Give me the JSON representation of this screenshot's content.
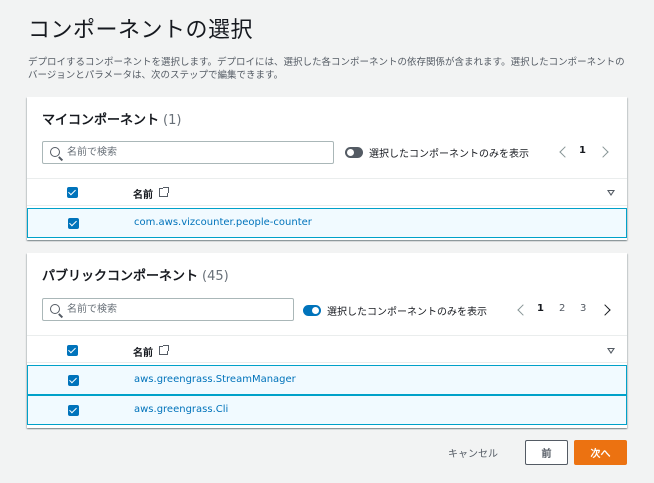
{
  "page": {
    "title": "コンポーネントの選択",
    "description": "デプロイするコンポーネントを選択します。デプロイには、選択した各コンポーネントの依存関係が含まれます。選択したコンポーネントのバージョンとパラメータは、次のステップで編集できます。"
  },
  "my_components": {
    "title": "マイコンポーネント",
    "count": "(1)",
    "search_placeholder": "名前で検索",
    "toggle_label": "選択したコンポーネントのみを表示",
    "toggle_on": false,
    "pages": [
      "1"
    ],
    "current_page": "1",
    "column_name": "名前",
    "rows": [
      {
        "name": "com.aws.vizcounter.people-counter",
        "checked": true
      }
    ]
  },
  "public_components": {
    "title": "パブリックコンポーネント",
    "count": "(45)",
    "search_placeholder": "名前で検索",
    "toggle_label": "選択したコンポーネントのみを表示",
    "toggle_on": true,
    "pages": [
      "1",
      "2",
      "3"
    ],
    "current_page": "1",
    "column_name": "名前",
    "rows": [
      {
        "name": "aws.greengrass.StreamManager",
        "checked": true
      },
      {
        "name": "aws.greengrass.Cli",
        "checked": true
      }
    ]
  },
  "footer": {
    "cancel_label": "キャンセル",
    "prev_label": "前",
    "next_label": "次へ"
  },
  "colors": {
    "primary": "#0073bb",
    "accent": "#ec7211",
    "selected_row_bg": "#f1faff",
    "selected_row_border": "#00a1c9"
  },
  "icons": [
    "search-icon",
    "external-link-icon",
    "sort-desc-icon",
    "chevron-left-icon",
    "chevron-right-icon",
    "checkbox-checked-icon",
    "toggle-icon"
  ]
}
